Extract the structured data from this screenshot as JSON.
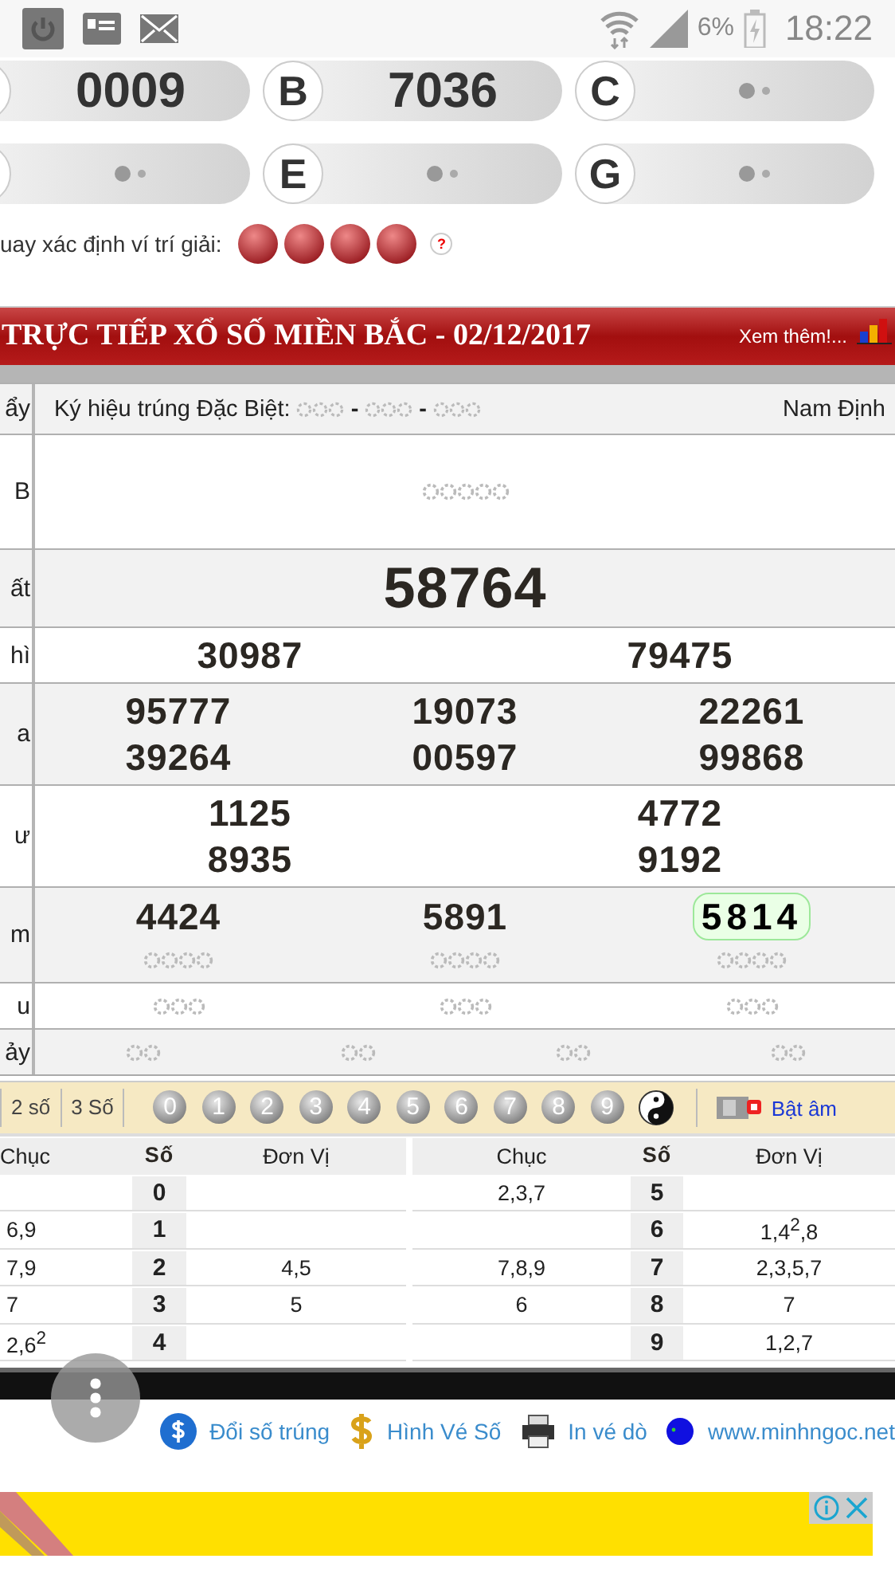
{
  "status_bar": {
    "battery": "6%",
    "time": "18:22"
  },
  "quick_results": [
    {
      "value": "0009",
      "kind": "number"
    },
    {
      "letter": "B",
      "value": "7036",
      "kind": "number"
    },
    {
      "letter": "C",
      "kind": "pending"
    },
    {
      "kind": "pending"
    },
    {
      "letter": "E",
      "kind": "pending"
    },
    {
      "letter": "G",
      "kind": "pending"
    }
  ],
  "draw_position": {
    "label": "uay xác định ví trí giải:",
    "help": "?"
  },
  "results_header": {
    "title": "TRỰC TIẾP XỔ SỐ MIỀN BẮC - 02/12/2017",
    "more_link": "Xem thêm!..."
  },
  "results_table": {
    "header": {
      "label": "ẩy",
      "code_label": "Ký hiệu trúng Đặc Biệt:",
      "separators": [
        "-",
        "-"
      ],
      "province": "Nam Định"
    },
    "rows": [
      {
        "label": "B",
        "lines": [
          [
            {
              "kind": "pending_long"
            }
          ]
        ]
      },
      {
        "label": "ất",
        "lines": [
          [
            {
              "kind": "featured",
              "value": "58764"
            }
          ]
        ]
      },
      {
        "label": "hì",
        "lines": [
          [
            {
              "kind": "number",
              "value": "30987",
              "highlighted": false
            },
            {
              "kind": "number",
              "value": "79475",
              "highlighted": false
            }
          ]
        ]
      },
      {
        "label": "a",
        "lines": [
          [
            {
              "kind": "number",
              "value": "95777",
              "highlighted": false
            },
            {
              "kind": "number",
              "value": "19073",
              "highlighted": false
            },
            {
              "kind": "number",
              "value": "22261",
              "highlighted": false
            }
          ],
          [
            {
              "kind": "number",
              "value": "39264",
              "highlighted": false
            },
            {
              "kind": "number",
              "value": "00597",
              "highlighted": false
            },
            {
              "kind": "number",
              "value": "99868",
              "highlighted": false
            }
          ]
        ]
      },
      {
        "label": "ư",
        "lines": [
          [
            {
              "kind": "number",
              "value": "1125",
              "highlighted": false
            },
            {
              "kind": "number",
              "value": "4772",
              "highlighted": false
            }
          ],
          [
            {
              "kind": "number",
              "value": "8935",
              "highlighted": false
            },
            {
              "kind": "number",
              "value": "9192",
              "highlighted": false
            }
          ]
        ]
      },
      {
        "label": "m",
        "lines": [
          [
            {
              "kind": "number",
              "value": "4424",
              "highlighted": false
            },
            {
              "kind": "number",
              "value": "5891",
              "highlighted": false
            },
            {
              "kind": "number",
              "value": "5814",
              "highlighted": true
            }
          ],
          [
            {
              "kind": "pending_medium"
            },
            {
              "kind": "pending_medium"
            },
            {
              "kind": "pending_medium"
            }
          ]
        ]
      },
      {
        "label": "u",
        "lines": [
          [
            {
              "kind": "pending_short"
            },
            {
              "kind": "pending_short"
            },
            {
              "kind": "pending_short"
            }
          ]
        ]
      },
      {
        "label": "ảy",
        "lines": [
          [
            {
              "kind": "pending_tiny"
            },
            {
              "kind": "pending_tiny"
            },
            {
              "kind": "pending_tiny"
            },
            {
              "kind": "pending_tiny"
            }
          ]
        ]
      }
    ]
  },
  "toolbar": {
    "modes": [
      {
        "label": "2 số"
      },
      {
        "label": "3 Số"
      }
    ],
    "digit_balls": [
      "0",
      "1",
      "2",
      "3",
      "4",
      "5",
      "6",
      "7",
      "8",
      "9"
    ],
    "sound_label": "Bật âm"
  },
  "loto_table": {
    "left": {
      "columns": [
        "Chục",
        "Số",
        "Đơn Vị"
      ],
      "rows": [
        {
          "digit": "0"
        },
        {
          "tens": "6,9",
          "digit": "1"
        },
        {
          "tens": "7,9",
          "digit": "2",
          "units": "4,5"
        },
        {
          "tens": "7",
          "digit": "3",
          "units": "5"
        },
        {
          "tens": "2,6$^{2}$",
          "digit": "4"
        }
      ]
    },
    "right": {
      "columns": [
        "Chục",
        "Số",
        "Đơn Vị"
      ],
      "rows": [
        {
          "tens": "2,3,7",
          "digit": "5"
        },
        {
          "digit": "6",
          "units": "1,4$^{2}$,8"
        },
        {
          "tens": "7,8,9",
          "digit": "7",
          "units": "2,3,5,7"
        },
        {
          "tens": "6",
          "digit": "8",
          "units": "7"
        },
        {
          "digit": "9",
          "units": "1,2,7"
        }
      ]
    }
  },
  "footer_links": [
    {
      "label": "Đổi số trúng",
      "kind": "coin"
    },
    {
      "label": "Hình Vé Số",
      "kind": "dollar"
    },
    {
      "label": "In vé dò",
      "kind": "printer"
    },
    {
      "label": "www.minhngoc.net",
      "kind": "globe"
    }
  ]
}
